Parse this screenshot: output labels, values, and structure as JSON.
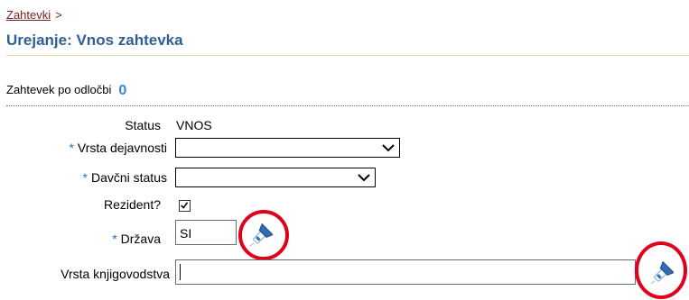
{
  "breadcrumb": {
    "link": "Zahtevki",
    "separator": ">"
  },
  "page_title": "Urejanje: Vnos zahtevka",
  "count_row": {
    "label": "Zahtevek po odločbi",
    "value": "0"
  },
  "form": {
    "status": {
      "label": "Status",
      "value": "VNOS"
    },
    "vrsta_dejavnosti": {
      "label": "Vrsta dejavnosti",
      "required_mark": "*",
      "value": ""
    },
    "davcni_status": {
      "label": "Davčni status",
      "required_mark": "*",
      "value": ""
    },
    "rezident": {
      "label": "Rezident?",
      "checked": true,
      "check_glyph": "✓"
    },
    "drzava": {
      "label": "Država",
      "required_mark": "*",
      "value": "SI",
      "lookup_icon": "flashlight-search-icon"
    },
    "vrsta_knjigovodstva": {
      "label": "Vrsta knjigovodstva",
      "value": "",
      "lookup_icon": "flashlight-search-icon"
    }
  },
  "colors": {
    "title": "#2f5f98",
    "link": "#7a1f1f",
    "count": "#3a86c8",
    "required": "#2f6fb0",
    "annotation": "#e0001a"
  }
}
